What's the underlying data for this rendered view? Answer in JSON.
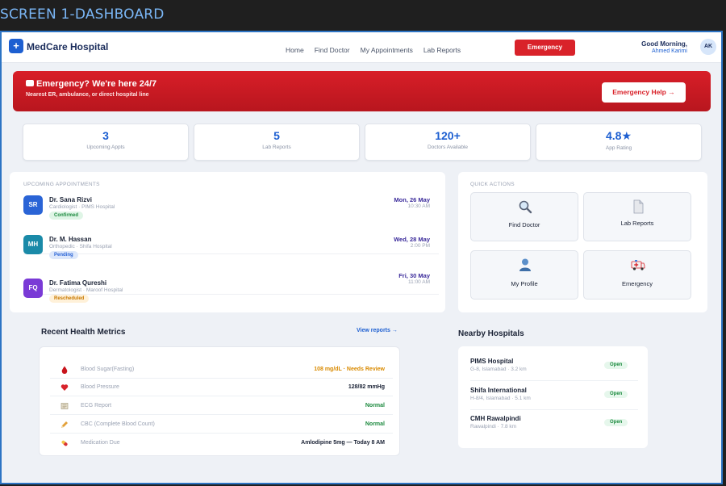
{
  "screen_label": "SCREEN 1-DASHBOARD",
  "header": {
    "logo_glyph": "+",
    "brand": "MedCare Hospital",
    "nav": [
      "Home",
      "Find Doctor",
      "My Appointments",
      "Lab Reports"
    ],
    "emergency_label": "Emergency",
    "greeting": "Good Morning,",
    "user_name": "Ahmed Karimi",
    "avatar_initials": "AK"
  },
  "banner": {
    "title": "Emergency? We're here 24/7",
    "subtitle": "Nearest ER, ambulance, or direct hospital line",
    "button_label": "Emergency Help →"
  },
  "stats": [
    {
      "value": "3",
      "label": "Upcoming Appts"
    },
    {
      "value": "5",
      "label": "Lab Reports"
    },
    {
      "value": "120+",
      "label": "Doctors Available"
    },
    {
      "value": "4.8★",
      "label": "App Rating"
    }
  ],
  "appointments": {
    "label": "UPCOMING APPOINTMENTS",
    "items": [
      {
        "initials": "SR",
        "name": "Dr. Sana Rizvi",
        "specialty": "Cardiologist · PIMS Hospital",
        "status": "Confirmed",
        "date": "Mon, 26 May",
        "time": "10:30 AM",
        "color": "#2a64d6",
        "badge_bg": "#dff5e6",
        "badge_fg": "#1d8a3f"
      },
      {
        "initials": "MH",
        "name": "Dr. M. Hassan",
        "specialty": "Orthopedic · Shifa Hospital",
        "status": "Pending",
        "date": "Wed, 28 May",
        "time": "2:00 PM",
        "color": "#1a8aa8",
        "badge_bg": "#dde8fb",
        "badge_fg": "#2a64d6"
      },
      {
        "initials": "FQ",
        "name": "Dr. Fatima Qureshi",
        "specialty": "Dermatologist · Maroof Hospital",
        "status": "Rescheduled",
        "date": "Fri, 30 May",
        "time": "11:00 AM",
        "color": "#7a3ad6",
        "badge_bg": "#fff1d9",
        "badge_fg": "#c77800"
      }
    ]
  },
  "quick_actions": {
    "label": "QUICK ACTIONS",
    "items": [
      {
        "label": "Find Doctor",
        "icon": "magnifier-icon"
      },
      {
        "label": "Lab Reports",
        "icon": "document-icon"
      },
      {
        "label": "My Profile",
        "icon": "person-icon"
      },
      {
        "label": "Emergency",
        "icon": "ambulance-icon"
      }
    ]
  },
  "health_metrics": {
    "title": "Recent Health Metrics",
    "link": "View reports →",
    "rows": [
      {
        "icon": "blood-drop-icon",
        "label": "Blood Sugar(Fasting)",
        "value": "108 mg/dL · Needs Review",
        "color": "#d98a00"
      },
      {
        "icon": "heart-icon",
        "label": "Blood Pressure",
        "value": "128/82 mmHg",
        "color": "#1a2235"
      },
      {
        "icon": "report-icon",
        "label": "ECG Report",
        "value": "Normal",
        "color": "#1d8a3f"
      },
      {
        "icon": "pencil-icon",
        "label": "CBC (Complete Blood Count)",
        "value": "Normal",
        "color": "#1d8a3f"
      },
      {
        "icon": "pill-icon",
        "label": "Medication Due",
        "value": "Amlodipine 5mg — Today 8 AM",
        "color": "#1a2235"
      }
    ]
  },
  "nearby": {
    "title": "Nearby Hospitals",
    "items": [
      {
        "name": "PIMS Hospital",
        "meta": "G-8, Islamabad · 3.2 km",
        "status": "Open"
      },
      {
        "name": "Shifa International",
        "meta": "H-8/4, Islamabad · 5.1 km",
        "status": "Open"
      },
      {
        "name": "CMH Rawalpindi",
        "meta": "Rawalpindi · 7.8 km",
        "status": "Open"
      }
    ]
  }
}
